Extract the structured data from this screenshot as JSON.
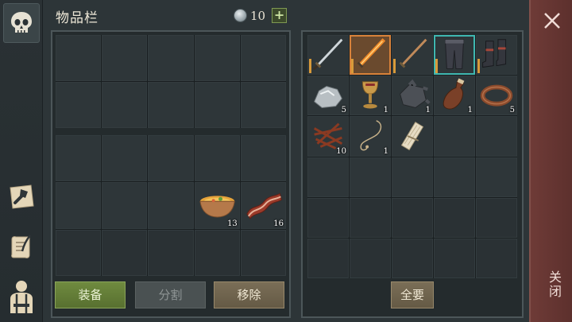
{
  "header": {
    "title": "物品栏",
    "coins": "10",
    "add_label": "+"
  },
  "sidebar": {
    "tabs": [
      {
        "name": "inventory",
        "icon": "skull-icon",
        "active": true
      },
      {
        "name": "craft",
        "icon": "hammer-map-icon"
      },
      {
        "name": "recipes",
        "icon": "scroll-quill-icon"
      },
      {
        "name": "character",
        "icon": "character-silhouette-icon"
      }
    ]
  },
  "left_panel": {
    "bottom_items": [
      {
        "icon": "soup-bowl-icon",
        "qty": "13"
      },
      {
        "icon": "bacon-icon",
        "qty": "16"
      }
    ]
  },
  "right_panel": {
    "items": [
      {
        "icon": "sword-icon",
        "qty": ""
      },
      {
        "icon": "fire-sword-icon",
        "qty": ""
      },
      {
        "icon": "bronze-sword-icon",
        "qty": ""
      },
      {
        "icon": "leg-armor-icon",
        "qty": ""
      },
      {
        "icon": "boots-icon",
        "qty": ""
      },
      {
        "icon": "stone-icon",
        "qty": "5"
      },
      {
        "icon": "goblet-icon",
        "qty": "1"
      },
      {
        "icon": "gear-chunk-icon",
        "qty": "1"
      },
      {
        "icon": "leather-bottle-icon",
        "qty": "1"
      },
      {
        "icon": "leather-strap-icon",
        "qty": "5"
      },
      {
        "icon": "rope-bundle-icon",
        "qty": "10"
      },
      {
        "icon": "necklace-icon",
        "qty": "1"
      },
      {
        "icon": "bandage-roll-icon",
        "qty": ""
      }
    ]
  },
  "buttons": {
    "equip": "装备",
    "split": "分割",
    "remove": "移除",
    "take_all": "全要"
  },
  "close": {
    "label": "关闭"
  },
  "colors": {
    "equip_green": "#6f8a3f",
    "remove_brown": "#7a6e57",
    "close_red": "#6e3b37"
  }
}
